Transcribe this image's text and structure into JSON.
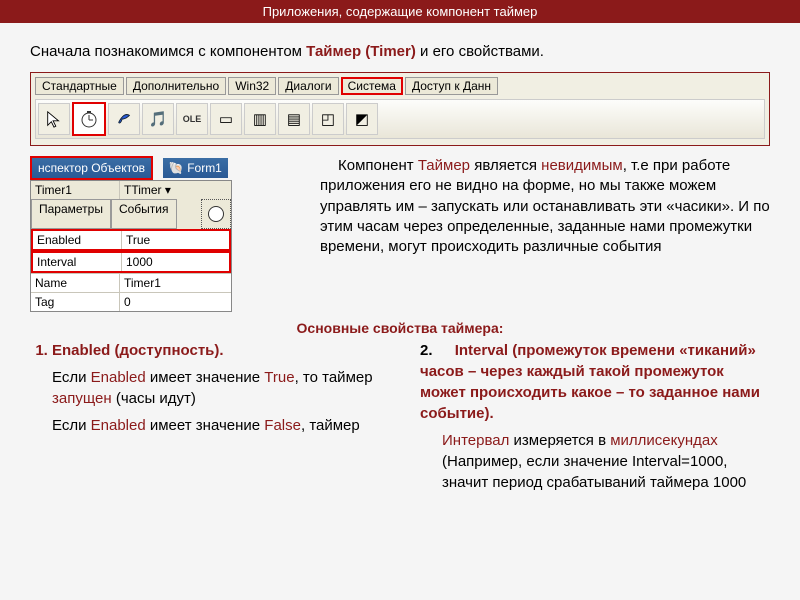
{
  "title": "Приложения, содержащие компонент таймер",
  "intro": {
    "pre": "Сначала познакомимся с компонентом ",
    "comp": "Таймер (Timer)",
    "post": " и его свойствами."
  },
  "tabs": {
    "t1": "Стандартные",
    "t2": "Дополнительно",
    "t3": "Win32",
    "t4": "Диалоги",
    "t5": "Система",
    "t6": "Доступ к Данн"
  },
  "toolbar": {
    "ole": "OLE"
  },
  "inspector": {
    "title": "нспектор Объектов",
    "form": "Form1",
    "obj_l": "Timer1",
    "obj_r": "TTimer",
    "tab_params": "Параметры",
    "tab_events": "События",
    "p_enabled_l": "Enabled",
    "p_enabled_v": "True",
    "p_interval_l": "Interval",
    "p_interval_v": "1000",
    "p_name_l": "Name",
    "p_name_v": "Timer1",
    "p_tag_l": "Tag",
    "p_tag_v": "0"
  },
  "desc": {
    "t1": "Компонент ",
    "t2": "Таймер",
    "t3": " является ",
    "t4": "невидимым",
    "t5": ", т.е при работе приложения его не видно на форме, но мы также можем управлять им – запускать или останавливать эти «часики». И по этим часам через определенные, заданные нами промежутки времени, могут происходить различные события"
  },
  "section_header": "Основные свойства таймера:",
  "left": {
    "li1": "Enabled (доступность).",
    "p1a": "Если ",
    "p1b": "Enabled",
    "p1c": " имеет значение ",
    "p1d": "True",
    "p1e": ", то таймер ",
    "p1f": "запущен",
    "p1g": " (часы идут)",
    "p2a": "Если ",
    "p2b": "Enabled",
    "p2c": " имеет значение ",
    "p2d": "False",
    "p2e": ", таймер"
  },
  "right": {
    "num": "2.",
    "h1": "Interval",
    "h2": " (промежуток времени «тиканий» часов – через каждый такой промежуток может происходить какое – то заданное нами событие).",
    "p1a": "Интервал",
    "p1b": " измеряется в ",
    "p1c": "миллисекундах",
    "p1d": " (Например, если значение Interval=1000, значит период срабатываний таймера 1000"
  }
}
